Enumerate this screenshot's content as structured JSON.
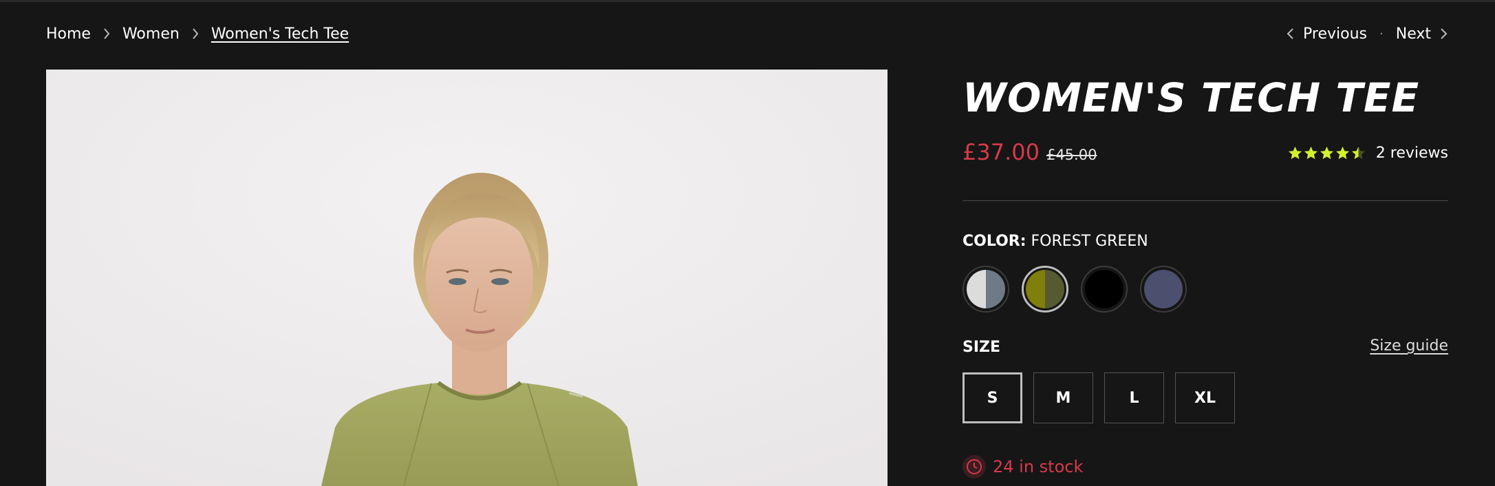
{
  "breadcrumb": {
    "home": "Home",
    "women": "Women",
    "current": "Women's Tech Tee"
  },
  "pager": {
    "previous": "Previous",
    "next": "Next"
  },
  "product": {
    "title": "WOMEN'S TECH TEE",
    "sale_price": "£37.00",
    "compare_price": "£45.00",
    "rating_value": 4.5,
    "rating_max": 5,
    "reviews": "2 reviews",
    "color_key": "COLOR:",
    "color_value": "FOREST GREEN",
    "swatches": [
      {
        "name": "white-grey",
        "left": "#dcdcdc",
        "right": "#6e7b86"
      },
      {
        "name": "forest-green",
        "left": "#7f7f0c",
        "right": "#565a31"
      },
      {
        "name": "black",
        "left": "#000000",
        "right": "#000000"
      },
      {
        "name": "navy",
        "left": "#4c4f6d",
        "right": "#4c4f6d"
      }
    ],
    "size_label": "SIZE",
    "size_guide": "Size guide",
    "sizes": [
      "S",
      "M",
      "L",
      "XL"
    ],
    "selected_size": "S",
    "stock": "24 in stock"
  },
  "colors": {
    "accent_red": "#d8394a",
    "star_color": "#d4ef2e",
    "background": "#161616"
  }
}
